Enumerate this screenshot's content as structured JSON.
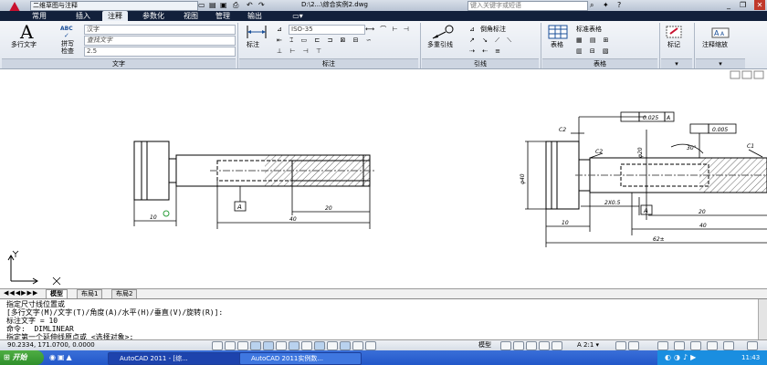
{
  "window": {
    "workspace": "二维草图与注释",
    "title": "D:\\2...\\综合实例2.dwg",
    "help_search_placeholder": "键入关键字或短语"
  },
  "tabs": [
    "常用",
    "插入",
    "注释",
    "参数化",
    "视图",
    "管理",
    "输出"
  ],
  "active_tab": "注释",
  "ribbon": {
    "text_panel": {
      "mtext_label": "多行文字",
      "spell_label": "拼写检查",
      "abc_label": "ABC",
      "style_value": "汉字",
      "find_placeholder": "查找文字",
      "height_value": "2.5",
      "title": "文字"
    },
    "dim_panel": {
      "dim_label": "标注",
      "style_value": "ISO-35",
      "title": "标注"
    },
    "leader_panel": {
      "multileader_label": "多重引线",
      "style_value": "倒角标注",
      "title": "引线"
    },
    "table_panel": {
      "table_label": "表格",
      "style_value": "标准表格",
      "title": "表格"
    },
    "markup_panel": {
      "label": "标记"
    },
    "scale_panel": {
      "label": "注释缩放"
    }
  },
  "drawing": {
    "left_dims": {
      "d1": "10",
      "d2": "40",
      "d3": "20",
      "datum": "A"
    },
    "right_dims": {
      "tol1": "0.025",
      "tol1_ref": "A",
      "tol2": "0.005",
      "c2a": "C2",
      "c2b": "C2",
      "c1": "C1",
      "angle": "30°",
      "phi_a": "φ20",
      "phi_b": "φ40",
      "thread": "2X0.5",
      "d10": "10",
      "d20": "20",
      "d40": "40",
      "d62": "62±",
      "datum": "A"
    }
  },
  "layout_tabs": [
    "模型",
    "布局1",
    "布局2"
  ],
  "command": {
    "lines": [
      "指定尺寸线位置或",
      "[多行文字(M)/文字(T)/角度(A)/水平(H)/垂直(V)/旋转(R)]:",
      "标注文字 = 10",
      "命令:  DIMLINEAR",
      "指定第一个延伸线原点或 <选择对象>:"
    ]
  },
  "status": {
    "coords": "90.2334,  171.0700, 0.0000",
    "model": "模型",
    "scale": "A 2:1 ▾"
  },
  "taskbar": {
    "start": "开始",
    "tasks": [
      "AutoCAD 2011 - [综...",
      "AutoCAD 2011实例数..."
    ],
    "clock": "11:43"
  }
}
